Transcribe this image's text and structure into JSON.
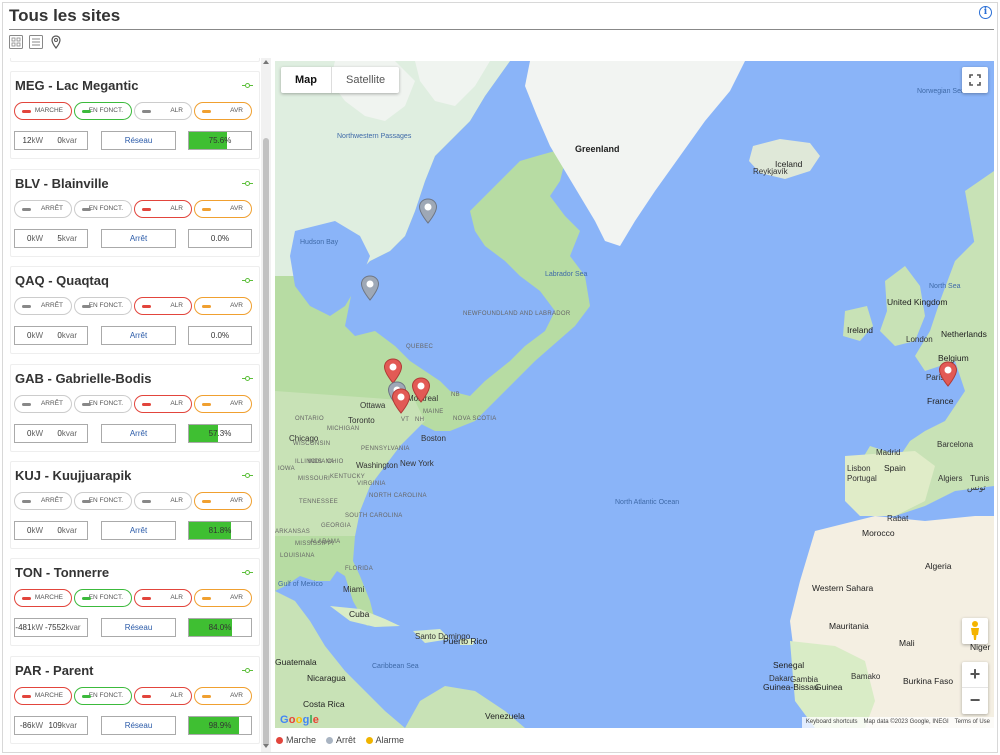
{
  "page": {
    "title": "Tous les sites"
  },
  "colors": {
    "marche": "#e2453c",
    "arret": "#a9b4c2",
    "alarme": "#f0b400",
    "bar": "#3fbf32"
  },
  "sites": [
    {
      "title": "MEG - Lac Megantic",
      "pills": [
        {
          "label": "MARCHE",
          "state": "on-red"
        },
        {
          "label": "EN FONCT.",
          "state": "on-green"
        },
        {
          "label": "ALR",
          "state": "off"
        },
        {
          "label": "AVR",
          "state": "on-orange"
        }
      ],
      "kw": "12",
      "kvar": "0",
      "mode": "Réseau",
      "pct": 75.6,
      "pct_label": "75.6%"
    },
    {
      "title": "BLV - Blainville",
      "pills": [
        {
          "label": "ARRÊT",
          "state": "off"
        },
        {
          "label": "EN FONCT.",
          "state": "off"
        },
        {
          "label": "ALR",
          "state": "on-red"
        },
        {
          "label": "AVR",
          "state": "on-orange"
        }
      ],
      "kw": "0",
      "kvar": "5",
      "mode": "Arrêt",
      "pct": 0,
      "pct_label": "0.0%"
    },
    {
      "title": "QAQ - Quaqtaq",
      "pills": [
        {
          "label": "ARRÊT",
          "state": "off"
        },
        {
          "label": "EN FONCT.",
          "state": "off"
        },
        {
          "label": "ALR",
          "state": "on-red"
        },
        {
          "label": "AVR",
          "state": "on-orange"
        }
      ],
      "kw": "0",
      "kvar": "0",
      "mode": "Arrêt",
      "pct": 0,
      "pct_label": "0.0%"
    },
    {
      "title": "GAB - Gabrielle-Bodis",
      "pills": [
        {
          "label": "ARRÊT",
          "state": "off"
        },
        {
          "label": "EN FONCT.",
          "state": "off"
        },
        {
          "label": "ALR",
          "state": "on-red"
        },
        {
          "label": "AVR",
          "state": "on-orange"
        }
      ],
      "kw": "0",
      "kvar": "0",
      "mode": "Arrêt",
      "pct": 57.3,
      "pct_label": "57.3%"
    },
    {
      "title": "KUJ - Kuujjuarapik",
      "pills": [
        {
          "label": "ARRÊT",
          "state": "off"
        },
        {
          "label": "EN FONCT.",
          "state": "off"
        },
        {
          "label": "ALR",
          "state": "off"
        },
        {
          "label": "AVR",
          "state": "on-orange"
        }
      ],
      "kw": "0",
      "kvar": "0",
      "mode": "Arrêt",
      "pct": 81.8,
      "pct_label": "81.8%"
    },
    {
      "title": "TON - Tonnerre",
      "pills": [
        {
          "label": "MARCHE",
          "state": "on-red"
        },
        {
          "label": "EN FONCT.",
          "state": "on-green"
        },
        {
          "label": "ALR",
          "state": "on-red"
        },
        {
          "label": "AVR",
          "state": "on-orange"
        }
      ],
      "kw": "-481",
      "kvar": "-7552",
      "mode": "Réseau",
      "pct": 84.0,
      "pct_label": "84.0%"
    },
    {
      "title": "PAR - Parent",
      "pills": [
        {
          "label": "MARCHE",
          "state": "on-red"
        },
        {
          "label": "EN FONCT.",
          "state": "on-green"
        },
        {
          "label": "ALR",
          "state": "on-red"
        },
        {
          "label": "AVR",
          "state": "on-orange"
        }
      ],
      "kw": "-86",
      "kvar": "109",
      "mode": "Réseau",
      "pct": 98.9,
      "pct_label": "98.9%"
    }
  ],
  "units": {
    "kw": "kW",
    "kvar": "kvar"
  },
  "map": {
    "type_map": "Map",
    "type_satellite": "Satellite",
    "google": "Google",
    "attribution": [
      "Keyboard shortcuts",
      "Map data ©2023 Google, INEGI",
      "Terms of Use"
    ],
    "labels": [
      {
        "t": "Greenland",
        "c": "big"
      },
      {
        "t": "Iceland",
        "c": "country"
      },
      {
        "t": "Reykjavík",
        "c": ""
      },
      {
        "t": "Norwegian Sea",
        "c": "ocean"
      },
      {
        "t": "Northwestern Passages",
        "c": "ocean"
      },
      {
        "t": "Hudson Bay",
        "c": "ocean"
      },
      {
        "t": "Labrador Sea",
        "c": "ocean"
      },
      {
        "t": "NEWFOUNDLAND AND LABRADOR",
        "c": "region"
      },
      {
        "t": "QUEBEC",
        "c": "region"
      },
      {
        "t": "North Sea",
        "c": "ocean"
      },
      {
        "t": "United Kingdom",
        "c": "country"
      },
      {
        "t": "Ireland",
        "c": "country"
      },
      {
        "t": "London",
        "c": ""
      },
      {
        "t": "Netherlands",
        "c": "country"
      },
      {
        "t": "Belgium",
        "c": "country"
      },
      {
        "t": "Paris",
        "c": ""
      },
      {
        "t": "France",
        "c": "country"
      },
      {
        "t": "Spain",
        "c": "country"
      },
      {
        "t": "Barcelona",
        "c": ""
      },
      {
        "t": "Madrid",
        "c": ""
      },
      {
        "t": "Lisbon",
        "c": ""
      },
      {
        "t": "Portugal",
        "c": ""
      },
      {
        "t": "Algiers",
        "c": ""
      },
      {
        "t": "Tunis",
        "c": ""
      },
      {
        "t": "تونس",
        "c": ""
      },
      {
        "t": "Rabat",
        "c": ""
      },
      {
        "t": "Morocco",
        "c": "country"
      },
      {
        "t": "Algeria",
        "c": "country"
      },
      {
        "t": "Western Sahara",
        "c": "country"
      },
      {
        "t": "Mauritania",
        "c": "country"
      },
      {
        "t": "Mali",
        "c": "country"
      },
      {
        "t": "Niger",
        "c": "country"
      },
      {
        "t": "Senegal",
        "c": "country"
      },
      {
        "t": "Guinea-Bissau",
        "c": "country"
      },
      {
        "t": "Gambia",
        "c": ""
      },
      {
        "t": "Guinea",
        "c": "country"
      },
      {
        "t": "Bamako",
        "c": ""
      },
      {
        "t": "Burkina Faso",
        "c": "country"
      },
      {
        "t": "Dakar",
        "c": ""
      },
      {
        "t": "North Atlantic Ocean",
        "c": "ocean"
      },
      {
        "t": "Ottawa",
        "c": ""
      },
      {
        "t": "Montreal",
        "c": ""
      },
      {
        "t": "Toronto",
        "c": ""
      },
      {
        "t": "ONTARIO",
        "c": "region"
      },
      {
        "t": "MAINE",
        "c": "region"
      },
      {
        "t": "NOVA SCOTIA",
        "c": "region"
      },
      {
        "t": "NB",
        "c": "region"
      },
      {
        "t": "VT",
        "c": "region"
      },
      {
        "t": "NH",
        "c": "region"
      },
      {
        "t": "Boston",
        "c": ""
      },
      {
        "t": "New York",
        "c": ""
      },
      {
        "t": "Chicago",
        "c": ""
      },
      {
        "t": "Washington",
        "c": ""
      },
      {
        "t": "MICHIGAN",
        "c": "region"
      },
      {
        "t": "WISCONSIN",
        "c": "region"
      },
      {
        "t": "ILLINOIS",
        "c": "region"
      },
      {
        "t": "INDIANA",
        "c": "region"
      },
      {
        "t": "OHIO",
        "c": "region"
      },
      {
        "t": "PENNSYLVANIA",
        "c": "region"
      },
      {
        "t": "IOWA",
        "c": "region"
      },
      {
        "t": "MISSOURI",
        "c": "region"
      },
      {
        "t": "KENTUCKY",
        "c": "region"
      },
      {
        "t": "VIRGINIA",
        "c": "region"
      },
      {
        "t": "TENNESSEE",
        "c": "region"
      },
      {
        "t": "NORTH CAROLINA",
        "c": "region"
      },
      {
        "t": "SOUTH CAROLINA",
        "c": "region"
      },
      {
        "t": "GEORGIA",
        "c": "region"
      },
      {
        "t": "ALABAMA",
        "c": "region"
      },
      {
        "t": "MISSISSIPPI",
        "c": "region"
      },
      {
        "t": "ARKANSAS",
        "c": "region"
      },
      {
        "t": "LOUISIANA",
        "c": "region"
      },
      {
        "t": "FLORIDA",
        "c": "region"
      },
      {
        "t": "Gulf of Mexico",
        "c": "ocean"
      },
      {
        "t": "Miami",
        "c": ""
      },
      {
        "t": "Cuba",
        "c": "country"
      },
      {
        "t": "Santo Domingo",
        "c": ""
      },
      {
        "t": "Puerto Rico",
        "c": "country"
      },
      {
        "t": "Caribbean Sea",
        "c": "ocean"
      },
      {
        "t": "Nicaragua",
        "c": "country"
      },
      {
        "t": "Costa Rica",
        "c": "country"
      },
      {
        "t": "Venezuela",
        "c": "country"
      },
      {
        "t": "Guatemala",
        "c": "country"
      }
    ]
  },
  "legend": [
    {
      "label": "Marche",
      "color": "#e2453c"
    },
    {
      "label": "Arrêt",
      "color": "#a9b4c2"
    },
    {
      "label": "Alarme",
      "color": "#f0b400"
    }
  ]
}
